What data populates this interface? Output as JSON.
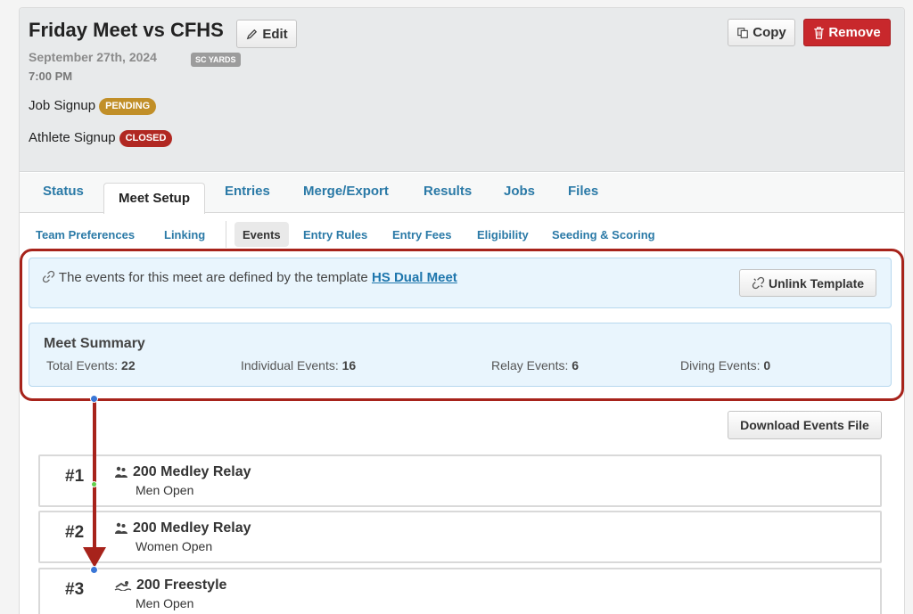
{
  "meet": {
    "title": "Friday Meet vs CFHS",
    "date": "September 27th, 2024",
    "course_badge": "SC YARDS",
    "time": "7:00 PM"
  },
  "actions": {
    "edit": "Edit",
    "copy": "Copy",
    "remove": "Remove"
  },
  "signup": {
    "job_label": "Job Signup",
    "job_status": "PENDING",
    "athlete_label": "Athlete Signup",
    "athlete_status": "CLOSED"
  },
  "tabs": [
    "Status",
    "Meet Setup",
    "Entries",
    "Merge/Export",
    "Results",
    "Jobs",
    "Files"
  ],
  "subtabs": [
    "Team Preferences",
    "Linking",
    "Events",
    "Entry Rules",
    "Entry Fees",
    "Eligibility",
    "Seeding & Scoring"
  ],
  "template_notice": {
    "text": "The events for this meet are defined by the template",
    "link": "HS Dual Meet",
    "unlink_button": "Unlink Template"
  },
  "summary": {
    "title": "Meet Summary",
    "total_label": "Total Events:",
    "total": "22",
    "individual_label": "Individual Events:",
    "individual": "16",
    "relay_label": "Relay Events:",
    "relay": "6",
    "diving_label": "Diving Events:",
    "diving": "0"
  },
  "download_button": "Download Events File",
  "events": [
    {
      "number": "#1",
      "icon": "relay-icon",
      "name": "200 Medley Relay",
      "desc": "Men Open"
    },
    {
      "number": "#2",
      "icon": "relay-icon",
      "name": "200 Medley Relay",
      "desc": "Women Open"
    },
    {
      "number": "#3",
      "icon": "swimmer-icon",
      "name": "200 Freestyle",
      "desc": "Men Open"
    }
  ],
  "colors": {
    "link_blue": "#2b7aa7",
    "remove_red": "#c8282c",
    "pending_gold": "#c18f28",
    "closed_red": "#b12822",
    "annotation_red": "#a7231b"
  }
}
